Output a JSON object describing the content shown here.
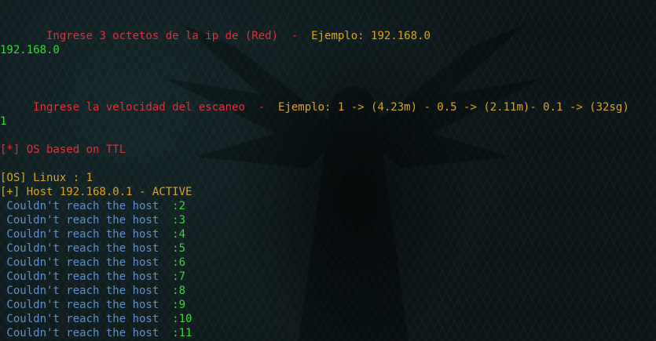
{
  "colors": {
    "background": "#0d1618",
    "red": "#e0303a",
    "gold": "#d9a51f",
    "green": "#3ad63a",
    "blue": "#5f8fd0"
  },
  "prompts": {
    "octets": {
      "label": "   Ingrese 3 octetos de la ip de (Red)  - ",
      "example": " Ejemplo: 192.168.0"
    },
    "octets_input": "192.168.0",
    "speed": {
      "label": " Ingrese la velocidad del escaneo  - ",
      "example": " Ejemplo: 1 -> (4.23m) - 0.5 -> (2.11m)- 0.1 -> (32sg)"
    },
    "speed_input": "1"
  },
  "scan": {
    "os_header": "[*] OS based on TTL",
    "os_result": "[OS] Linux : 1",
    "active_host": "[+] Host 192.168.0.1 - ACTIVE",
    "unreachable_text": " Couldn't reach the host  ",
    "unreachable_hosts": [
      ":2",
      ":3",
      ":4",
      ":5",
      ":6",
      ":7",
      ":8",
      ":9",
      ":10",
      ":11"
    ]
  }
}
